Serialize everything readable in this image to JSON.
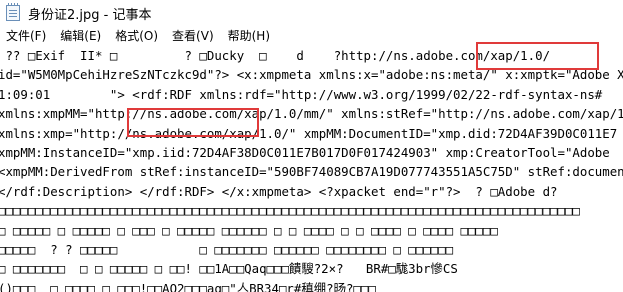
{
  "window": {
    "title": "身份证2.jpg - 记事本"
  },
  "menu": [
    {
      "label": "文件(F)"
    },
    {
      "label": "编辑(E)"
    },
    {
      "label": "格式(O)"
    },
    {
      "label": "查看(V)"
    },
    {
      "label": "帮助(H)"
    }
  ],
  "editor": {
    "lines": [
      " ?? □Exif  II* □         ? □Ducky  □    d    ?http://ns.adobe.com/xap/1.0/",
      "id=\"W5M0MpCehiHzreSzNTczkc9d\"?> <x:xmpmeta xmlns:x=\"adobe:ns:meta/\" x:xmptk=\"Adobe XMP",
      "1:09:01        \"> <rdf:RDF xmlns:rdf=\"http://www.w3.org/1999/02/22-rdf-syntax-ns#",
      "xmlns:xmpMM=\"http://ns.adobe.com/xap/1.0/mm/\" xmlns:stRef=\"http://ns.adobe.com/xap/1.0/",
      "xmlns:xmp=\"http://ns.adobe.com/xap/1.0/\" xmpMM:DocumentID=\"xmp.did:72D4AF39D0C011E7",
      "xmpMM:InstanceID=\"xmp.iid:72D4AF38D0C011E7B017D0F017424903\" xmp:CreatorTool=\"Adobe",
      "<xmpMM:DerivedFrom stRef:instanceID=\"590BF74089CB7A19D077743551A5C75D\" stRef:documentID",
      "</rdf:Description> </rdf:RDF> </x:xmpmeta> <?xpacket end=\"r\"?>  ? □Adobe d?",
      "□□□□□□□□□□□□□□□□□□□□□□□□□□□□□□□□□□□□□□□□□□□□□□□□□□□□□□□□□□□□□□□□□□□□□□□□□□□□□□",
      "□ □□□□□ □ □□□□□ □ □□□ □ □□□□□ □□□□□□ □ □ □□□□ □ □ □□□□ □ □□□□ □□□□□",
      "□□□□□  ? ? □□□□□           □ □□□□□□□ □□□□□□ □□□□□□□□ □ □□□□□□",
      "□ □□□□□□□  □ □ □□□□□ □ □□! □□1A□□Qaq□□□饋騪?2×?   BR#□駹3br慘CS",
      "()□□□  □ □□□□ □ □□□!□□AQ2□□□aq□\"亼BR34□r#稹绷?旸?□□□"
    ]
  }
}
